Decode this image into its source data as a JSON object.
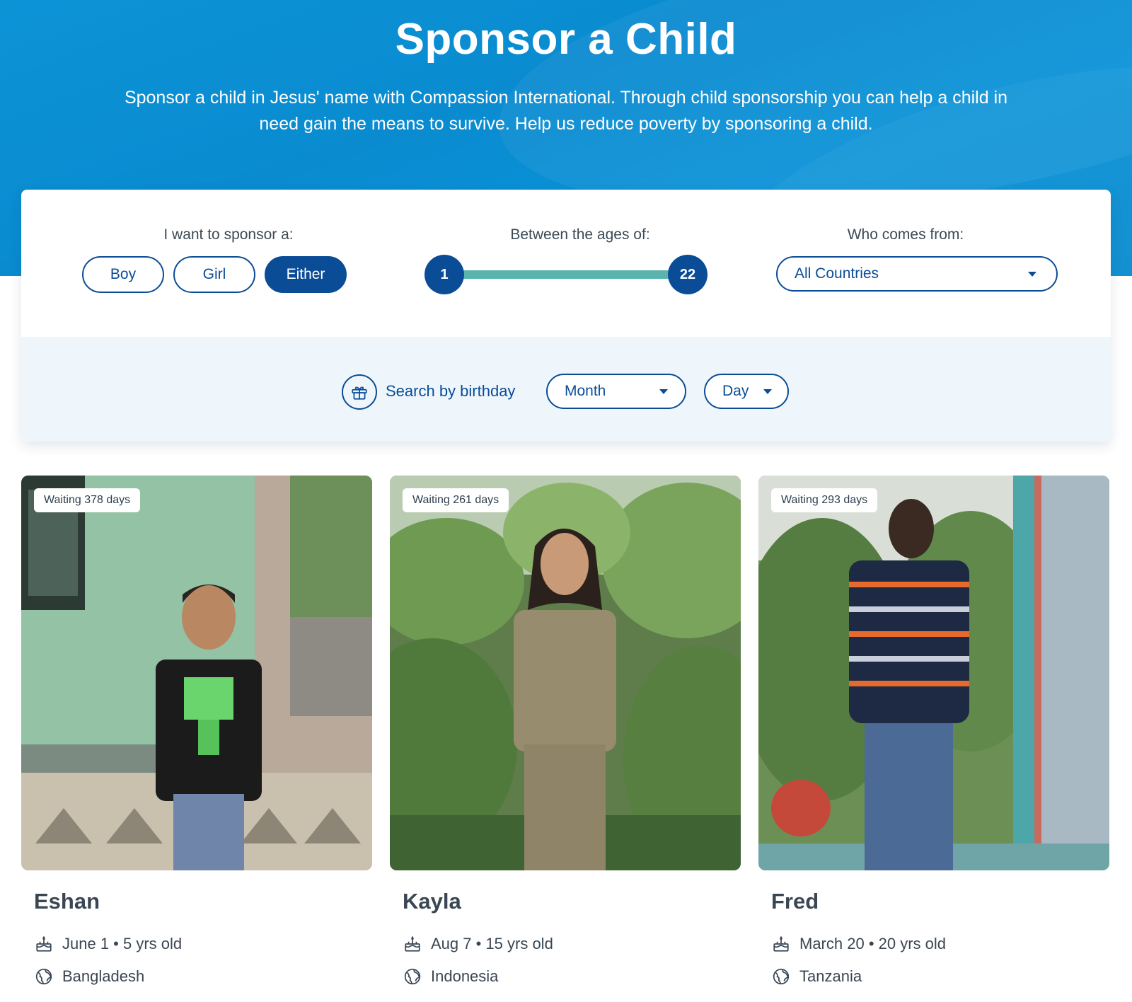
{
  "hero": {
    "title": "Sponsor a Child",
    "subtitle": "Sponsor a child in Jesus' name with Compassion International. Through child sponsorship you can help a child in need gain the means to survive. Help us reduce poverty by sponsoring a child."
  },
  "filters": {
    "gender_label": "I want to sponsor a:",
    "gender_options": [
      "Boy",
      "Girl",
      "Either"
    ],
    "gender_selected": "Either",
    "age_label": "Between the ages of:",
    "age_min": "1",
    "age_max": "22",
    "country_label": "Who comes from:",
    "country_value": "All Countries",
    "birthday_label": "Search by birthday",
    "month_value": "Month",
    "day_value": "Day"
  },
  "children": [
    {
      "name": "Eshan",
      "waiting": "Waiting 378 days",
      "birthday": "June 1 • 5 yrs old",
      "country": "Bangladesh"
    },
    {
      "name": "Kayla",
      "waiting": "Waiting 261 days",
      "birthday": "Aug 7 • 15 yrs old",
      "country": "Indonesia"
    },
    {
      "name": "Fred",
      "waiting": "Waiting 293 days",
      "birthday": "March 20 • 20 yrs old",
      "country": "Tanzania"
    }
  ],
  "colors": {
    "hero_blue": "#0b8fd3",
    "brand_navy": "#0b4c97",
    "slider_teal": "#5ab3ad",
    "panel_light": "#eef6fc"
  },
  "icons": {
    "gift": "gift-icon",
    "birthday": "birthday-cake-icon",
    "country": "globe-icon",
    "dropdown": "caret-down-icon"
  }
}
